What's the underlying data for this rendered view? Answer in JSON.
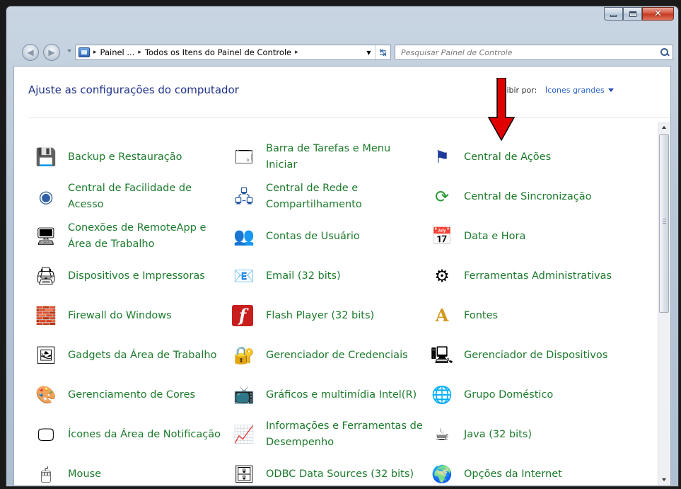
{
  "window": {
    "min_glyph": "minimize",
    "max_glyph": "maximize",
    "close_glyph": "x"
  },
  "address": {
    "crumb1": "Painel ...",
    "crumb2": "Todos os Itens do Painel de Controle",
    "sep": "▸"
  },
  "search": {
    "placeholder": "Pesquisar Painel de Controle"
  },
  "header": {
    "title": "Ajuste as configurações do computador",
    "viewby_label": "Exibir por:",
    "viewby_value": "Ícones grandes"
  },
  "items": [
    {
      "label": "Backup e Restauração",
      "icon": "backup-icon"
    },
    {
      "label": "Barra de Tarefas e Menu Iniciar",
      "icon": "taskbar-icon"
    },
    {
      "label": "Central de Ações",
      "icon": "action-center-flag-icon"
    },
    {
      "label": "Central de Facilidade de Acesso",
      "icon": "ease-of-access-icon"
    },
    {
      "label": "Central de Rede e Compartilhamento",
      "icon": "network-icon"
    },
    {
      "label": "Central de Sincronização",
      "icon": "sync-icon"
    },
    {
      "label": "Conexões de RemoteApp e Área de Trabalho",
      "icon": "remoteapp-icon"
    },
    {
      "label": "Contas de Usuário",
      "icon": "user-accounts-icon"
    },
    {
      "label": "Data e Hora",
      "icon": "date-time-icon"
    },
    {
      "label": "Dispositivos e Impressoras",
      "icon": "printer-icon"
    },
    {
      "label": "Email (32 bits)",
      "icon": "email-icon"
    },
    {
      "label": "Ferramentas Administrativas",
      "icon": "admin-tools-icon"
    },
    {
      "label": "Firewall do Windows",
      "icon": "firewall-icon"
    },
    {
      "label": "Flash Player (32 bits)",
      "icon": "flash-icon"
    },
    {
      "label": "Fontes",
      "icon": "fonts-icon"
    },
    {
      "label": "Gadgets da Área de Trabalho",
      "icon": "gadgets-icon"
    },
    {
      "label": "Gerenciador de Credenciais",
      "icon": "credentials-vault-icon"
    },
    {
      "label": "Gerenciador de Dispositivos",
      "icon": "device-manager-icon"
    },
    {
      "label": "Gerenciamento de Cores",
      "icon": "color-management-icon"
    },
    {
      "label": "Gráficos e multimídia Intel(R)",
      "icon": "intel-graphics-icon"
    },
    {
      "label": "Grupo Doméstico",
      "icon": "homegroup-icon"
    },
    {
      "label": "Ícones da Área de Notificação",
      "icon": "notification-area-icon"
    },
    {
      "label": "Informações e Ferramentas de Desempenho",
      "icon": "performance-icon"
    },
    {
      "label": "Java (32 bits)",
      "icon": "java-icon"
    },
    {
      "label": "Mouse",
      "icon": "mouse-icon"
    },
    {
      "label": "ODBC Data Sources (32 bits)",
      "icon": "odbc-icon"
    },
    {
      "label": "Opções da Internet",
      "icon": "internet-options-icon"
    }
  ],
  "colors": {
    "link_green": "#1d7a2c",
    "title_blue": "#1e3287",
    "arrow_red": "#e10000"
  }
}
